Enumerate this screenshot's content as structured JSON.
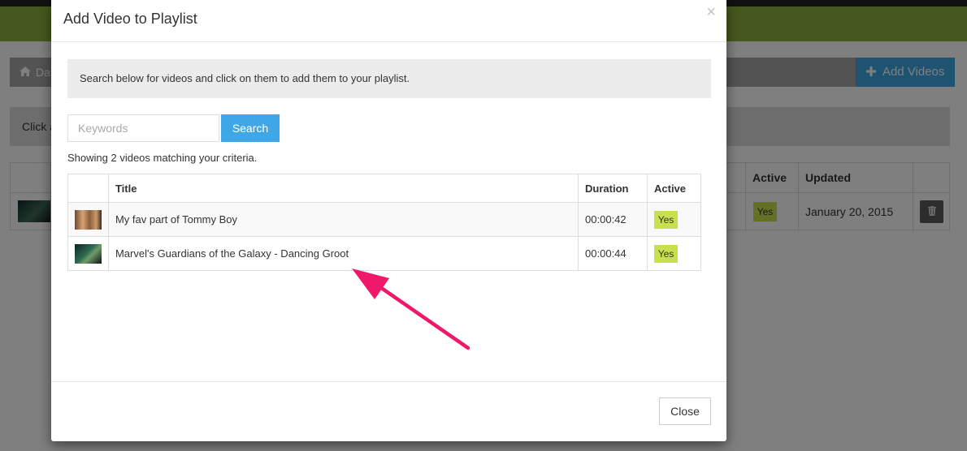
{
  "background": {
    "breadcrumb_label": "Das",
    "add_videos_label": "Add Videos",
    "info_text": "Click a",
    "table": {
      "headers": {
        "active": "Active",
        "updated": "Updated"
      },
      "row": {
        "active": "Yes",
        "updated": "January 20, 2015"
      }
    },
    "icons": [
      "home-icon",
      "plus-icon",
      "trash-icon"
    ]
  },
  "modal": {
    "title": "Add Video to Playlist",
    "close_x": "×",
    "instructions": "Search below for videos and click on them to add them to your playlist.",
    "search": {
      "placeholder": "Keywords",
      "value": "",
      "button_label": "Search"
    },
    "result_summary": "Showing 2 videos matching your criteria.",
    "table": {
      "headers": {
        "title": "Title",
        "duration": "Duration",
        "active": "Active"
      },
      "rows": [
        {
          "title": "My fav part of Tommy Boy",
          "duration": "00:00:42",
          "active": "Yes"
        },
        {
          "title": "Marvel's Guardians of the Galaxy - Dancing Groot",
          "duration": "00:00:44",
          "active": "Yes"
        }
      ]
    },
    "close_button_label": "Close"
  },
  "colors": {
    "brand_green": "#8cb13a",
    "primary_blue": "#3fa7e5",
    "active_badge": "#c8e04d",
    "annotation_arrow": "#f0186b"
  }
}
